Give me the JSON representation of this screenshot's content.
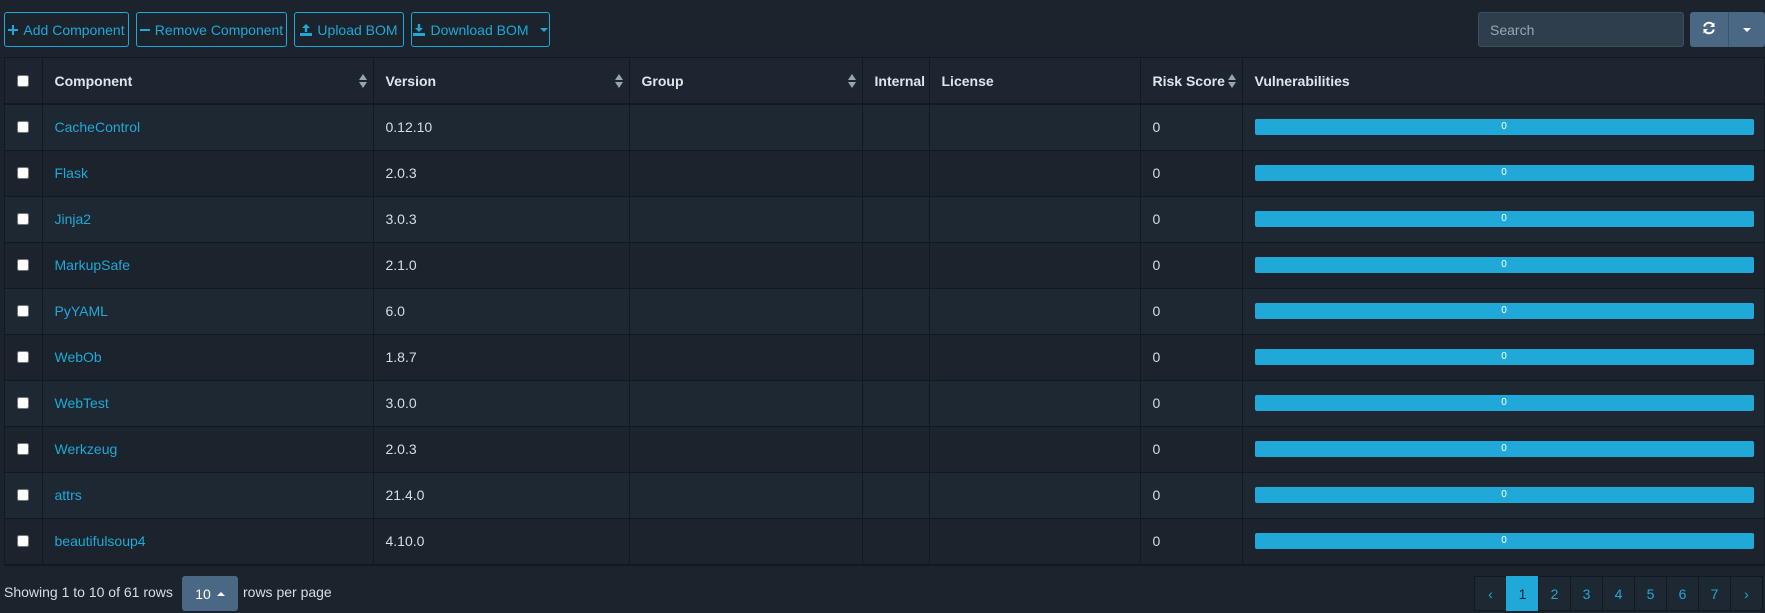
{
  "toolbar": {
    "add_label": "Add Component",
    "remove_label": "Remove Component",
    "upload_label": "Upload BOM",
    "download_label": "Download BOM"
  },
  "search": {
    "placeholder": "Search"
  },
  "table": {
    "columns": [
      "Component",
      "Version",
      "Group",
      "Internal",
      "License",
      "Risk Score",
      "Vulnerabilities"
    ],
    "rows": [
      {
        "component": "CacheControl",
        "version": "0.12.10",
        "group": "",
        "internal": "",
        "license": "",
        "risk_score": "0",
        "vulnerabilities": "0"
      },
      {
        "component": "Flask",
        "version": "2.0.3",
        "group": "",
        "internal": "",
        "license": "",
        "risk_score": "0",
        "vulnerabilities": "0"
      },
      {
        "component": "Jinja2",
        "version": "3.0.3",
        "group": "",
        "internal": "",
        "license": "",
        "risk_score": "0",
        "vulnerabilities": "0"
      },
      {
        "component": "MarkupSafe",
        "version": "2.1.0",
        "group": "",
        "internal": "",
        "license": "",
        "risk_score": "0",
        "vulnerabilities": "0"
      },
      {
        "component": "PyYAML",
        "version": "6.0",
        "group": "",
        "internal": "",
        "license": "",
        "risk_score": "0",
        "vulnerabilities": "0"
      },
      {
        "component": "WebOb",
        "version": "1.8.7",
        "group": "",
        "internal": "",
        "license": "",
        "risk_score": "0",
        "vulnerabilities": "0"
      },
      {
        "component": "WebTest",
        "version": "3.0.0",
        "group": "",
        "internal": "",
        "license": "",
        "risk_score": "0",
        "vulnerabilities": "0"
      },
      {
        "component": "Werkzeug",
        "version": "2.0.3",
        "group": "",
        "internal": "",
        "license": "",
        "risk_score": "0",
        "vulnerabilities": "0"
      },
      {
        "component": "attrs",
        "version": "21.4.0",
        "group": "",
        "internal": "",
        "license": "",
        "risk_score": "0",
        "vulnerabilities": "0"
      },
      {
        "component": "beautifulsoup4",
        "version": "4.10.0",
        "group": "",
        "internal": "",
        "license": "",
        "risk_score": "0",
        "vulnerabilities": "0"
      }
    ]
  },
  "footer": {
    "showing_text": "Showing 1 to 10 of 61 rows",
    "per_page_value": "10",
    "per_page_suffix": "rows per page"
  },
  "pagination": {
    "prev": "‹",
    "pages": [
      "1",
      "2",
      "3",
      "4",
      "5",
      "6",
      "7"
    ],
    "next": "›",
    "active": "1"
  },
  "colors": {
    "accent": "#20a8d8",
    "background": "#1b232c",
    "button_secondary": "#4a6783"
  },
  "icons": {
    "add": "plus-icon",
    "remove": "minus-icon",
    "upload": "upload-icon",
    "download": "download-icon",
    "refresh": "refresh-icon"
  }
}
